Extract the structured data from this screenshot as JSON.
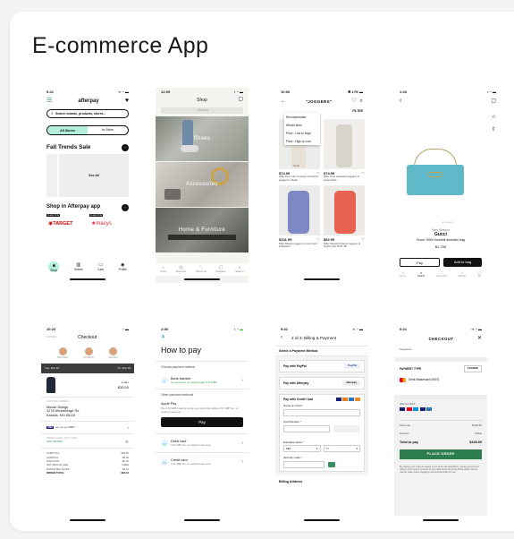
{
  "page_title": "E-commerce App",
  "s1": {
    "time": "9:41",
    "logo": "afterpay",
    "search_placeholder": "Search brands, products, stores...",
    "tab_all": "All Stores",
    "tab_instore": "In-Store",
    "section1": "Fall Trends Sale",
    "see_all": "See All",
    "section2": "Shop in Afterpay app",
    "badge1": "In-app Only",
    "badge2": "In-app Only",
    "store1": "TARGET",
    "store2": "macys",
    "nav": [
      "Shop",
      "Orders",
      "Card",
      "Profile"
    ]
  },
  "s2": {
    "time": "12:09",
    "header": "Shop",
    "search_placeholder": "Search",
    "tiles": [
      "Shoes",
      "Accessories",
      "Home & Furniture"
    ],
    "nav": [
      "Shop",
      "Discover",
      "Wish List",
      "Register",
      "Search"
    ]
  },
  "s3": {
    "time": "10:00",
    "query": "\"JOGGERS\"",
    "filter": "FILTER",
    "sort_options": [
      "Recommended",
      "What's New",
      "Price : Low to High",
      "Price : High to Low"
    ],
    "tag": "SALE",
    "items": [
      {
        "price": "$74.99",
        "name": "Nike Flex mini crossed oversized joggers in black"
      },
      {
        "price": "$74.99",
        "name": "Nike crew sweatsuit joggers in pearl white"
      },
      {
        "price": "$101.99",
        "name": "Nike Fleece joggers in navy and iridescent"
      },
      {
        "price": "$92.99",
        "name": "Nike Swoosh Fleece joggers in bright pink SUIT 38"
      }
    ]
  },
  "s4": {
    "time": "1:33",
    "label": "New Season",
    "brand": "Gucci",
    "product": "Gucci 1955 Horsebit shoulder bag",
    "price": "$1,750",
    "pay_label": "Pay",
    "add_label": "Add to bag",
    "nav": [
      "Home",
      "Search",
      "Favourites",
      "Wishlist",
      "Me"
    ]
  },
  "s5": {
    "time": "10:23",
    "title": "Checkout",
    "back": "CANCEL",
    "steps": [
      "DELIVERY",
      "PAYMENT",
      "REVIEW"
    ],
    "date1": "Tue, Mar 18",
    "date2": "Fri, Mar 18",
    "item_qty": "1 item",
    "item_price": "$35.00",
    "ship_label": "SHIPPING ADDRESS",
    "address": [
      "Mouse Design",
      "1278 Wickleberge Rd",
      "Kansas, MO 65110"
    ],
    "card_label": "VISA",
    "card_num": "•••• •••• •••• 9047",
    "promo_label": "PROMO CODE / GIFT CARD",
    "promo_add": "ADD PROMO",
    "summary": [
      {
        "k": "SUBTOTAL",
        "v": "$30.00"
      },
      {
        "k": "SHIPPING",
        "v": "$5.00"
      },
      {
        "k": "DISCOUNT",
        "v": "-$5.00"
      },
      {
        "k": "NET SPECIAL FEE",
        "v": "FREE"
      },
      {
        "k": "ESTIMATED TAXES",
        "v": "$2.16"
      },
      {
        "k": "ORDER TOTAL",
        "v": "$32.16"
      }
    ]
  },
  "s6": {
    "time": "2:36",
    "close": "✕",
    "title": "How to pay",
    "choose": "Choose payment method",
    "bank_title": "Bank transfer",
    "bank_sub": "No extra fees, so recipient gets 0.31 GBP",
    "other": "Other payment methods",
    "apple_title": "Apple Pay",
    "apple_desc": "Pay 4.03 GBP instantly using your Apple Pay wallet. 0.07 GBP fee, so recipient gets less.",
    "apple_btn": "Pay",
    "debit_title": "Debit card",
    "debit_sub": "0.31 GBP fee, so recipient gets less.",
    "credit_title": "Credit card",
    "credit_sub": "0.31 GBP fee, so recipient gets less."
  },
  "s7": {
    "time": "9:41",
    "step": "2 of 3: Billing & Payment",
    "select": "Select a Payment Method",
    "paypal": "Pay with PayPal",
    "paypal_logo": "PayPal",
    "afterpay": "Pay with Afterpay",
    "afterpay_logo": "afterpay",
    "credit": "Pay with Credit Card",
    "name_label": "Name on Card *",
    "number_label": "Card Number *",
    "exp_label": "Expiration Date *",
    "mm": "MM",
    "yy": "YY",
    "cvv_label": "Security Code *",
    "billing": "Billing Address"
  },
  "s8": {
    "time": "9:41",
    "title": "CHECKOUT",
    "address_top": "Singapore",
    "pay_type": "PAYMENT TYPE",
    "change": "CHANGE",
    "card": "Debit Mastercard (0637)",
    "we_accept": "WE ACCEPT:",
    "subtotal_k": "Sub-total",
    "subtotal_v": "$348.99",
    "delivery_k": "Delivery",
    "delivery_v": "FREE",
    "total_k": "Total to pay",
    "total_v": "$348.99",
    "place": "PLACE ORDER",
    "terms": "By placing your order you agree to our terms and conditions, privacy and returns policies and consent to some of your data being stored by ASOS which may be used to make future shopping experiences better for you.",
    "accent": "#2e7d4f"
  }
}
